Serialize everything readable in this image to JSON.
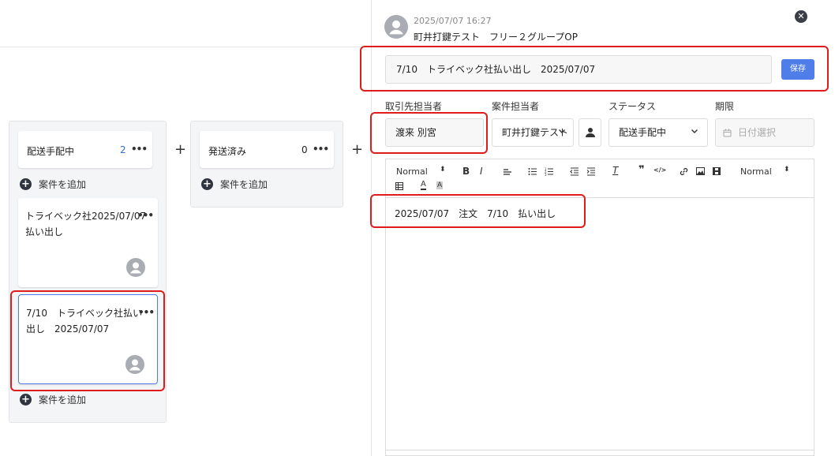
{
  "board": {
    "columns": [
      {
        "title": "配送手配中",
        "count": "2",
        "more": "•••",
        "add_label": "案件を追加",
        "cards": [
          {
            "line1": "トライベック社2025/07/07",
            "line2": "払い出し",
            "more": "•••"
          },
          {
            "line1": "7/10　トライベック社払い",
            "line2": "出し　2025/07/07",
            "more": "•••"
          }
        ],
        "footer_add_label": "案件を追加"
      },
      {
        "title": "発送済み",
        "count": "0",
        "more": "•••",
        "add_label": "案件を追加"
      }
    ],
    "add_column_symbol": "+"
  },
  "panel": {
    "timestamp": "2025/07/07 16:27",
    "user_line": "町井打鍵テスト　フリー２グループOP",
    "close_symbol": "✕",
    "title_value": "7/10　トライベック社払い出し　2025/07/07",
    "save_label": "保存",
    "fields": {
      "client_contact_label": "取引先担当者",
      "client_contact_value": "渡来 別宮",
      "case_owner_label": "案件担当者",
      "case_owner_value": "町井打鍵テスト",
      "status_label": "ステータス",
      "status_value": "配送手配中",
      "due_label": "期限",
      "due_placeholder": "日付選択"
    },
    "toolbar": {
      "header_select": "Normal",
      "size_select": "Normal",
      "bold": "B",
      "italic": "I",
      "quote": "❞",
      "code": "</>"
    },
    "editor_text": "2025/07/07　注文　7/10　払い出し"
  },
  "colors": {
    "accent": "#4f7ee8",
    "highlight": "#e01b1b",
    "count_blue": "#2f6fd6"
  }
}
